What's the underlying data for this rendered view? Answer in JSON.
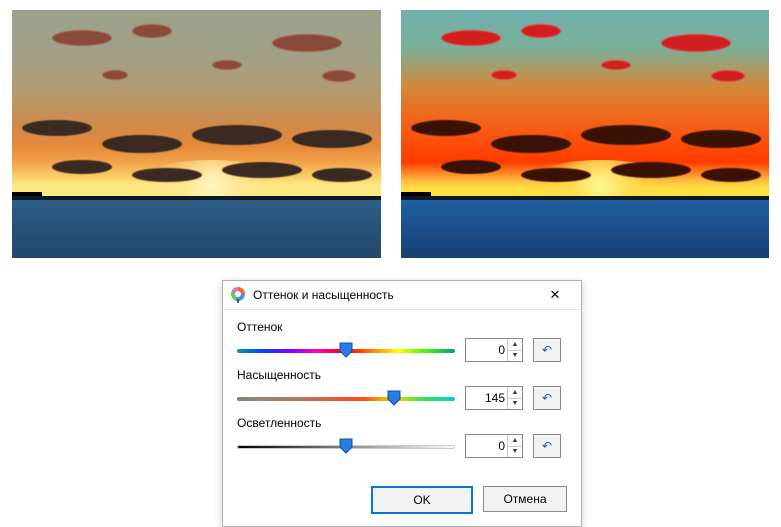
{
  "dialog": {
    "title": "Оттенок и насыщенность",
    "close_glyph": "✕",
    "sliders": {
      "hue": {
        "label": "Оттенок",
        "value": "0",
        "min": -180,
        "max": 180,
        "pos_pct": 50
      },
      "saturation": {
        "label": "Насыщенность",
        "value": "145",
        "min": 0,
        "max": 200,
        "pos_pct": 72
      },
      "lightness": {
        "label": "Осветленность",
        "value": "0",
        "min": -100,
        "max": 100,
        "pos_pct": 50
      }
    },
    "reset_glyph": "↶",
    "spinner_up_glyph": "▲",
    "spinner_down_glyph": "▼",
    "buttons": {
      "ok": "OK",
      "cancel": "Отмена"
    }
  },
  "images": {
    "left_alt": "original-sunset",
    "right_alt": "saturated-sunset"
  }
}
